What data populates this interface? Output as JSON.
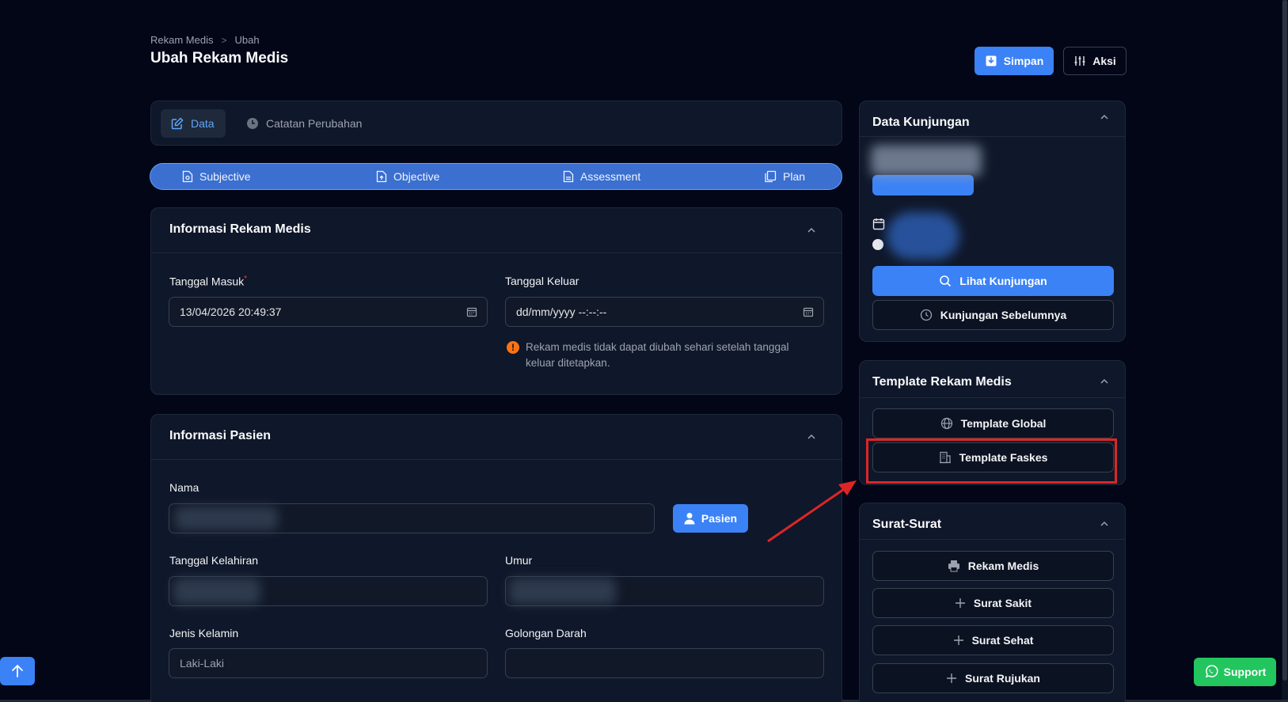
{
  "breadcrumb": {
    "root": "Rekam Medis",
    "separator": ">",
    "current": "Ubah"
  },
  "page_title": "Ubah Rekam Medis",
  "toolbar": {
    "save_label": "Simpan",
    "actions_label": "Aksi"
  },
  "tabs": {
    "data_label": "Data",
    "log_label": "Catatan Perubahan"
  },
  "soap": {
    "subjective": "Subjective",
    "objective": "Objective",
    "assessment": "Assessment",
    "plan": "Plan"
  },
  "info_rekam": {
    "title": "Informasi Rekam Medis",
    "tanggal_masuk_label": "Tanggal Masuk",
    "required_mark": "*",
    "tanggal_masuk_value": "13/04/2026 20:49:37",
    "tanggal_keluar_label": "Tanggal Keluar",
    "tanggal_keluar_placeholder": "dd/mm/yyyy --:--:--",
    "warning_icon": "!",
    "warning_text": "Rekam medis tidak dapat diubah sehari setelah tanggal keluar ditetapkan."
  },
  "info_pasien": {
    "title": "Informasi Pasien",
    "nama_label": "Nama",
    "pasien_button": "Pasien",
    "tanggal_lahir_label": "Tanggal Kelahiran",
    "umur_label": "Umur",
    "jenis_kelamin_label": "Jenis Kelamin",
    "jenis_kelamin_value": "Laki-Laki",
    "golongan_darah_label": "Golongan Darah"
  },
  "data_kunjungan": {
    "title": "Data Kunjungan",
    "lihat_button": "Lihat Kunjungan",
    "sebelumnya_button": "Kunjungan Sebelumnya"
  },
  "template": {
    "title": "Template Rekam Medis",
    "global_button": "Template Global",
    "faskes_button": "Template Faskes"
  },
  "surat": {
    "title": "Surat-Surat",
    "rekam_medis_button": "Rekam Medis",
    "sakit_button": "Surat Sakit",
    "sehat_button": "Surat Sehat",
    "rujukan_button": "Surat Rujukan"
  },
  "support_label": "Support",
  "colors": {
    "accent": "#3b82f6",
    "highlight": "#dc2626",
    "support": "#22c55e",
    "background": "#020617"
  }
}
